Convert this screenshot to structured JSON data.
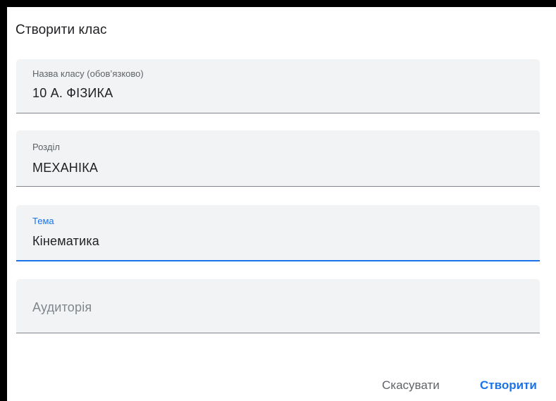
{
  "dialog": {
    "title": "Створити клас",
    "fields": [
      {
        "label": "Назва класу (обов’язково)",
        "value": "10 А. ФІЗИКА"
      },
      {
        "label": "Розділ",
        "value": "МЕХАНІКА"
      },
      {
        "label": "Тема",
        "value": "Кінематика"
      },
      {
        "placeholder": "Аудиторія"
      }
    ],
    "buttons": {
      "cancel": "Скасувати",
      "create": "Створити"
    }
  },
  "colors": {
    "accent": "#1a73e8",
    "field_background": "#f1f3f4",
    "text": "#202124",
    "secondary_text": "#5f6368"
  }
}
